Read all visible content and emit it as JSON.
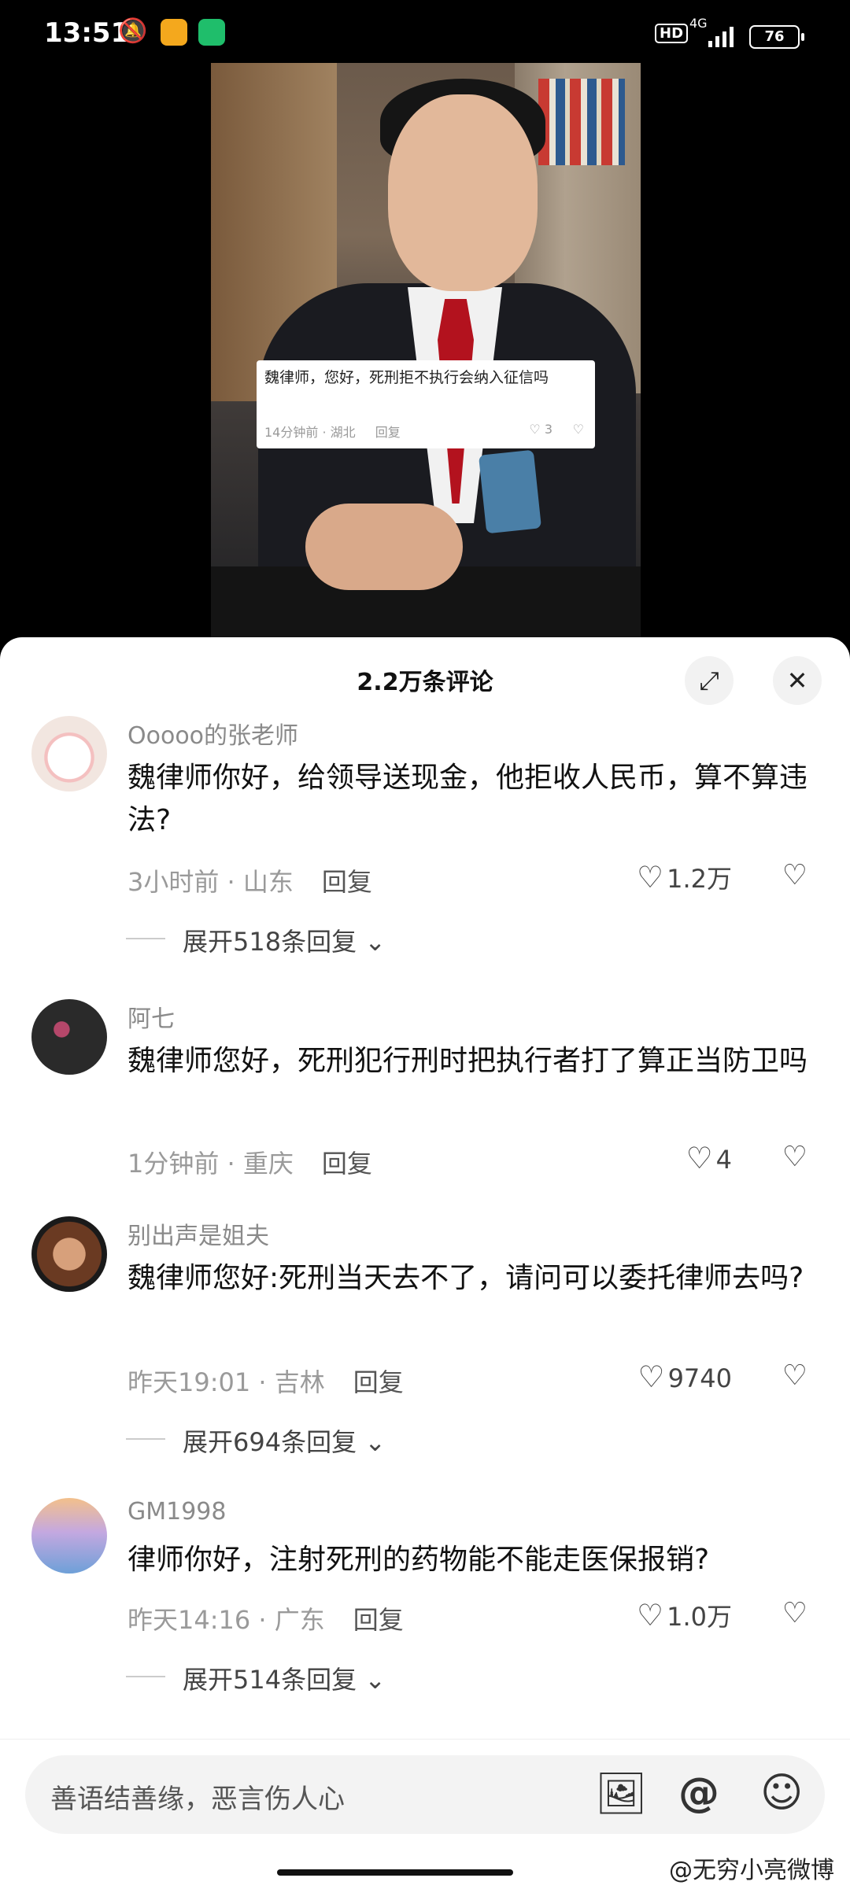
{
  "status_bar": {
    "time": "13:51",
    "hd": "HD",
    "network": "4G",
    "battery": "76"
  },
  "video": {
    "overlay_comment": {
      "text": "魏律师，您好，死刑拒不执行会纳入征信吗",
      "time_location": "14分钟前 · 湖北",
      "reply": "回复",
      "likes": "3"
    }
  },
  "comments_panel": {
    "title": "2.2万条评论",
    "comments": [
      {
        "user": "Ooooo的张老师",
        "text": "魏律师你好，给领导送现金，他拒收人民币，算不算违法?",
        "time_location": "3小时前 · 山东",
        "reply": "回复",
        "likes": "1.2万",
        "expand": "展开518条回复"
      },
      {
        "user": "阿七",
        "text": "魏律师您好，死刑犯行刑时把执行者打了算正当防卫吗",
        "time_location": "1分钟前 · 重庆",
        "reply": "回复",
        "likes": "4",
        "expand": ""
      },
      {
        "user": "别出声是姐夫",
        "text": "魏律师您好:死刑当天去不了，请问可以委托律师去吗?",
        "time_location": "昨天19:01 · 吉林",
        "reply": "回复",
        "likes": "9740",
        "expand": "展开694条回复"
      },
      {
        "user": "GM1998",
        "text": "律师你好，注射死刑的药物能不能走医保报销?",
        "time_location": "昨天14:16 · 广东",
        "reply": "回复",
        "likes": "1.0万",
        "expand": "展开514条回复"
      }
    ]
  },
  "input": {
    "placeholder": "善语结善缘，恶言伤人心"
  },
  "watermark": "@无穷小亮微博"
}
